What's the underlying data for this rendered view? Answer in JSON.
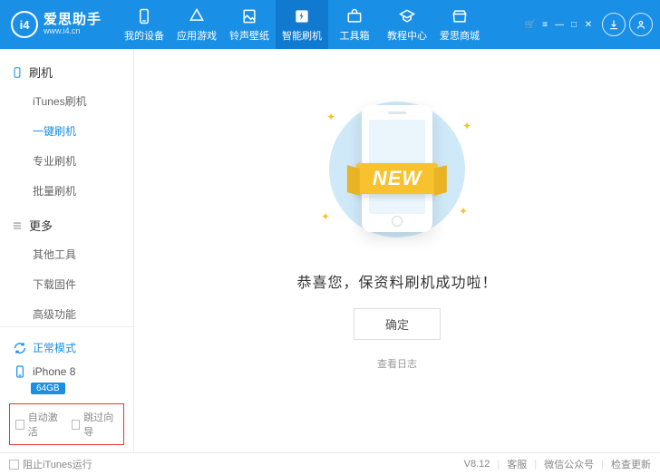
{
  "brand": {
    "name": "爱思助手",
    "url": "www.i4.cn",
    "badge": "i4"
  },
  "nav": [
    {
      "key": "device",
      "label": "我的设备"
    },
    {
      "key": "apps",
      "label": "应用游戏"
    },
    {
      "key": "ring",
      "label": "铃声壁纸"
    },
    {
      "key": "flash",
      "label": "智能刷机",
      "active": true
    },
    {
      "key": "tools",
      "label": "工具箱"
    },
    {
      "key": "tutorial",
      "label": "教程中心"
    },
    {
      "key": "store",
      "label": "爱思商城"
    }
  ],
  "sidebar": {
    "group1": {
      "title": "刷机",
      "items": [
        "iTunes刷机",
        "一键刷机",
        "专业刷机",
        "批量刷机"
      ],
      "activeIndex": 1
    },
    "group2": {
      "title": "更多",
      "items": [
        "其他工具",
        "下载固件",
        "高级功能"
      ]
    }
  },
  "mode": {
    "label": "正常模式"
  },
  "device": {
    "name": "iPhone 8",
    "capacity": "64GB"
  },
  "checks": {
    "autoActivate": "自动激活",
    "skipWizard": "跳过向导"
  },
  "content": {
    "ribbon": "NEW",
    "message": "恭喜您，保资料刷机成功啦！",
    "confirm": "确定",
    "viewLog": "查看日志"
  },
  "footer": {
    "blockItunes": "阻止iTunes运行",
    "version": "V8.12",
    "support": "客服",
    "wechat": "微信公众号",
    "update": "检查更新"
  }
}
